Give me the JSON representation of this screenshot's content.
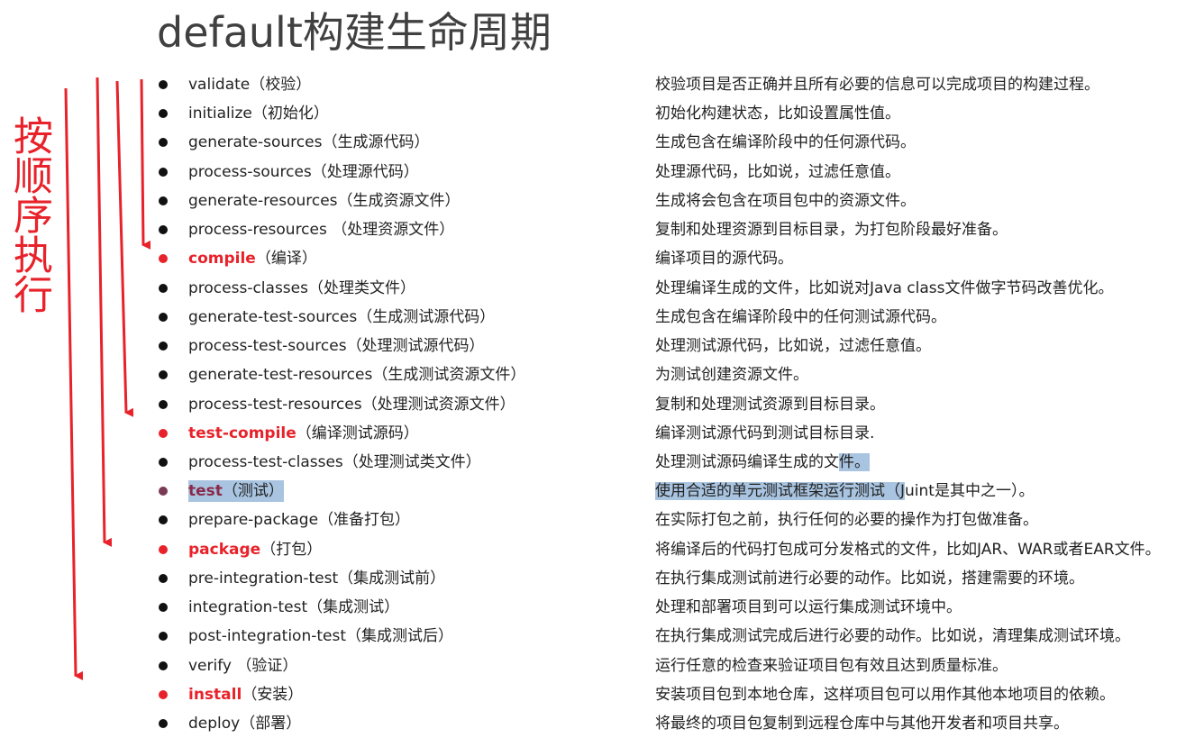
{
  "title": "default构建生命周期",
  "side_label": "按顺序执行",
  "colors": {
    "accent": "#e8222a",
    "text": "#222222",
    "selection": "#a9c4e0"
  },
  "phases": [
    {
      "name": "validate",
      "cn": "（校验）",
      "desc": "校验项目是否正确并且所有必要的信息可以完成项目的构建过程。",
      "key": false
    },
    {
      "name": "initialize",
      "cn": "（初始化）",
      "desc": "初始化构建状态，比如设置属性值。",
      "key": false
    },
    {
      "name": "generate-sources",
      "cn": "（生成源代码）",
      "desc": "生成包含在编译阶段中的任何源代码。",
      "key": false
    },
    {
      "name": "process-sources",
      "cn": "（处理源代码）",
      "desc": "处理源代码，比如说，过滤任意值。",
      "key": false
    },
    {
      "name": "generate-resources",
      "cn": "（生成资源文件）",
      "desc": "生成将会包含在项目包中的资源文件。",
      "key": false
    },
    {
      "name": "process-resources",
      "cn": " （处理资源文件）",
      "desc": "复制和处理资源到目标目录，为打包阶段最好准备。",
      "key": false
    },
    {
      "name": "compile",
      "cn": "（编译）",
      "desc": "编译项目的源代码。",
      "key": true
    },
    {
      "name": "process-classes",
      "cn": "（处理类文件）",
      "desc": "处理编译生成的文件，比如说对Java class文件做字节码改善优化。",
      "key": false
    },
    {
      "name": "generate-test-sources",
      "cn": "（生成测试源代码）",
      "desc": "生成包含在编译阶段中的任何测试源代码。",
      "key": false
    },
    {
      "name": "process-test-sources",
      "cn": "（处理测试源代码）",
      "desc": "处理测试源代码，比如说，过滤任意值。",
      "key": false
    },
    {
      "name": "generate-test-resources",
      "cn": "（生成测试资源文件）",
      "desc": "为测试创建资源文件。",
      "key": false
    },
    {
      "name": "process-test-resources",
      "cn": "（处理测试资源文件）",
      "desc": "复制和处理测试资源到目标目录。",
      "key": false
    },
    {
      "name": "test-compile",
      "cn": "（编译测试源码）",
      "desc": "编译测试源代码到测试目标目录.",
      "key": true
    },
    {
      "name": "process-test-classes",
      "cn": "（处理测试类文件）",
      "desc_a": "处理测试源码编译生成的文",
      "desc_b": "件。",
      "key": false,
      "partial_sel": true
    },
    {
      "name": "test",
      "cn": "（测试）",
      "desc_a": "使用合适的单元测试框架运行测试（J",
      "desc_b": "uint是其中之一）。",
      "key": true,
      "selected": true
    },
    {
      "name": "prepare-package",
      "cn": "（准备打包）",
      "desc": "在实际打包之前，执行任何的必要的操作为打包做准备。",
      "key": false
    },
    {
      "name": "package",
      "cn": "（打包）",
      "desc": "将编译后的代码打包成可分发格式的文件，比如JAR、WAR或者EAR文件。",
      "key": true
    },
    {
      "name": "pre-integration-test",
      "cn": "（集成测试前）",
      "desc": "在执行集成测试前进行必要的动作。比如说，搭建需要的环境。",
      "key": false
    },
    {
      "name": "integration-test",
      "cn": "（集成测试）",
      "desc": "处理和部署项目到可以运行集成测试环境中。",
      "key": false
    },
    {
      "name": "post-integration-test",
      "cn": "（集成测试后）",
      "desc": "在执行集成测试完成后进行必要的动作。比如说，清理集成测试环境。",
      "key": false
    },
    {
      "name": "verify",
      "cn": " （验证）",
      "desc": "运行任意的检查来验证项目包有效且达到质量标准。",
      "key": false
    },
    {
      "name": "install",
      "cn": "（安装）",
      "desc": "安装项目包到本地仓库，这样项目包可以用作其他本地项目的依赖。",
      "key": true
    },
    {
      "name": "deploy",
      "cn": "（部署）",
      "desc": "将最终的项目包复制到远程仓库中与其他开发者和项目共享。",
      "key": false
    }
  ]
}
